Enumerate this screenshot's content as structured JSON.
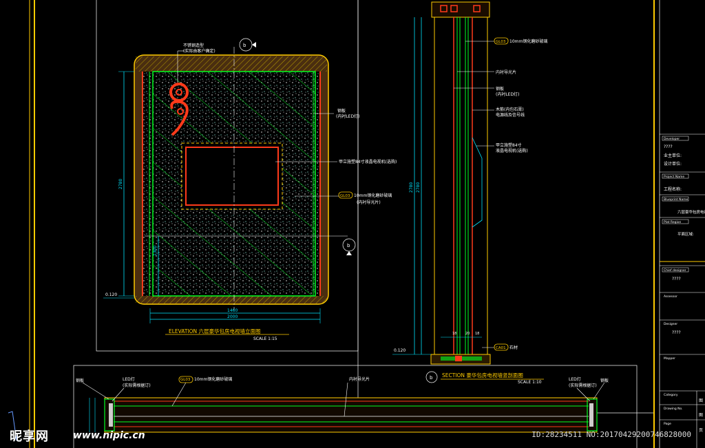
{
  "colors": {
    "background": "#000000",
    "frame": "#ffffff",
    "wall": "#ff3a1a",
    "glass": "#00ff22",
    "dim": "#00e5ff",
    "trim": "#c8b400",
    "dots": "#ffffff",
    "border": "#ffcc00",
    "panel_text": "#ff9900"
  },
  "elevation": {
    "title": "ELEVATION  六层豪华包房电视墙立面图",
    "scale": "SCALE  1:15",
    "callout_top_label": "b",
    "callout_right_label": "b",
    "notes": {
      "top_1": "不锈钢造型",
      "top_2": "(实际由客户确定)",
      "right_1": "钢板",
      "right_2": "(内衬LED灯)",
      "tv": "甲立施塑84寸液晶电视机(选购)",
      "glass_tag": "GL03",
      "glass": "10mm钢化磨砂玻璃",
      "glass_2": "(内衬导光片)"
    },
    "dims": {
      "height_left": "2780",
      "height_inner": "1300",
      "base": "0.120",
      "width_inner": "1460",
      "width_outer": "2000"
    }
  },
  "section": {
    "title": "SECTION  豪华包房电视墙竖剖面图",
    "scale": "SCALE  1:10",
    "callout_label": "b",
    "notes": {
      "gl_tag": "GL03",
      "gl": "10mm钢化磨砂玻璃",
      "guide": "内衬导光片",
      "steel_1": "钢板",
      "steel_2": "(内衬LED灯)",
      "wood_1": "木筋(内包石膏)",
      "wood_2": "电源线及信号线",
      "tv_1": "甲立施塑84寸",
      "tv_2": "液晶电视机(选购)"
    },
    "dims": {
      "height": "2780",
      "base": "0.120",
      "b1": "18",
      "b2": "20",
      "b3": "18"
    },
    "bottom_tag": "CA01",
    "bottom_note": "石材"
  },
  "plan": {
    "labels": {
      "steel_left": "钢板",
      "led_left_1": "LED灯",
      "led_left_2": "(实际需根据订)",
      "gl_tag": "GL03",
      "gl": "10mm钢化磨砂玻璃",
      "guide": "内衬导光片",
      "led_right_1": "LED灯",
      "led_right_2": "(实际需根据订)",
      "steel_right": "钢板"
    }
  },
  "title_block": {
    "developer_tag": "Developer",
    "developer_text": "业主单位:",
    "developer_value": "????",
    "dev_line2": "设计单位:",
    "project_tag": "Project Name",
    "project_text": "工程名称:",
    "blueprint_tag": "Blueprint Name",
    "blueprint_text": "六层豪华包房电视墙",
    "plat_tag": "Plat Region",
    "plat_text": "平面区域:",
    "chief_tag": "Chief designer",
    "chief_value": "????",
    "assessor_tag": "Assessor",
    "designer_tag": "Designer",
    "designer_value": "????",
    "mapper_tag": "Mapper",
    "category_tag": "Category",
    "drawing_tag": "Drawing No.",
    "page_tag": "Page",
    "small_a": "图",
    "small_b": "图",
    "small_c": "页"
  },
  "watermark": {
    "site": "昵享网",
    "url": "www.nipic.cn",
    "id": "ID:28234511 NO:20170429200746828000"
  }
}
